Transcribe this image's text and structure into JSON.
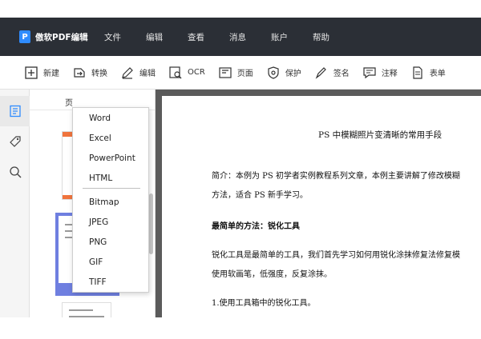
{
  "app": {
    "logo_glyph": "P",
    "title": "傲软PDF编辑",
    "accent": "#2f8cff"
  },
  "menu": [
    "文件",
    "编辑",
    "查看",
    "消息",
    "账户",
    "帮助"
  ],
  "toolbar": [
    {
      "icon": "plus-box-icon",
      "label": "新建"
    },
    {
      "icon": "convert-icon",
      "label": "转换"
    },
    {
      "icon": "edit-icon",
      "label": "编辑"
    },
    {
      "icon": "ocr-icon",
      "label": "OCR"
    },
    {
      "icon": "page-icon",
      "label": "页面"
    },
    {
      "icon": "shield-icon",
      "label": "保护"
    },
    {
      "icon": "pen-icon",
      "label": "签名"
    },
    {
      "icon": "comment-icon",
      "label": "注释"
    },
    {
      "icon": "form-icon",
      "label": "表单"
    }
  ],
  "thumbs": {
    "title": "页"
  },
  "convert_menu": {
    "group1": [
      "Word",
      "Excel",
      "PowerPoint",
      "HTML"
    ],
    "group2": [
      "Bitmap",
      "JPEG",
      "PNG",
      "GIF",
      "TIFF"
    ]
  },
  "document": {
    "title": "PS 中模糊照片变清晰的常用手段",
    "intro_line1": "简介：本例为 PS 初学者实例教程系列文章，本例主要讲解了修改模糊",
    "intro_line2": "方法，适合 PS 新手学习。",
    "heading": "最简单的方法：锐化工具",
    "para_line1": "锐化工具是最简单的工具，我们首先学习如何用锐化涂抹修复法修复模",
    "para_line2": "使用软画笔，低强度，反复涂抹。",
    "step1": "1.使用工具箱中的锐化工具。"
  }
}
